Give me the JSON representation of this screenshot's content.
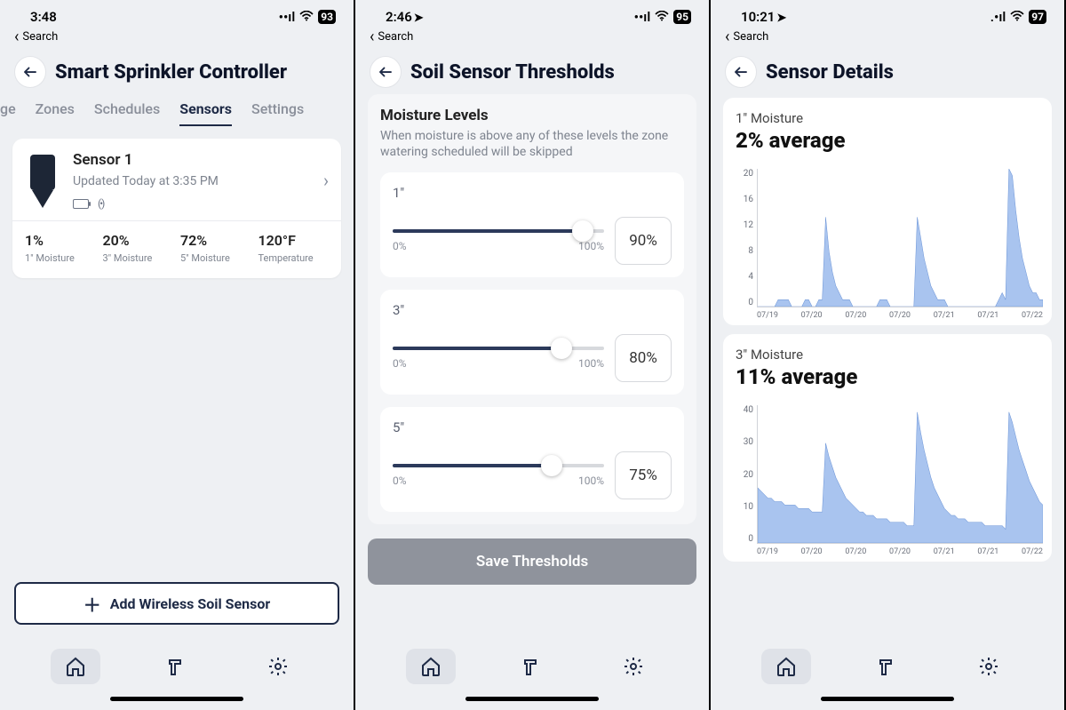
{
  "screens": [
    {
      "status": {
        "time": "3:48",
        "loc": false,
        "battery": "93"
      },
      "back_search": "Search",
      "title": "Smart Sprinkler Controller",
      "tabs": [
        {
          "label": "ge",
          "truncated": true
        },
        {
          "label": "Zones"
        },
        {
          "label": "Schedules"
        },
        {
          "label": "Sensors",
          "active": true
        },
        {
          "label": "Settings"
        }
      ],
      "sensor": {
        "name": "Sensor 1",
        "updated": "Updated Today at 3:35 PM",
        "metrics": [
          {
            "val": "1%",
            "lbl": "1\" Moisture"
          },
          {
            "val": "20%",
            "lbl": "3\" Moisture"
          },
          {
            "val": "72%",
            "lbl": "5\" Moisture"
          },
          {
            "val": "120°F",
            "lbl": "Temperature"
          }
        ]
      },
      "add_btn": "Add Wireless Soil Sensor"
    },
    {
      "status": {
        "time": "2:46",
        "loc": true,
        "battery": "95"
      },
      "back_search": "Search",
      "title": "Soil Sensor Thresholds",
      "section_title": "Moisture Levels",
      "section_desc": "When moisture is above any of these levels the zone watering scheduled will be skipped",
      "thresholds": [
        {
          "depth": "1\"",
          "pct": 90,
          "min": "0%",
          "max": "100%"
        },
        {
          "depth": "3\"",
          "pct": 80,
          "min": "0%",
          "max": "100%"
        },
        {
          "depth": "5\"",
          "pct": 75,
          "min": "0%",
          "max": "100%"
        }
      ],
      "save_btn": "Save Thresholds"
    },
    {
      "status": {
        "time": "10:21",
        "loc": true,
        "battery": "97"
      },
      "back_search": "Search",
      "title": "Sensor Details",
      "charts": [
        {
          "sub": "1\" Moisture",
          "title": "2% average"
        },
        {
          "sub": "3\" Moisture",
          "title": "11% average"
        }
      ]
    }
  ],
  "chart_data": [
    {
      "type": "area",
      "title": "1\" Moisture — 2% average",
      "xlabel": "",
      "ylabel": "",
      "ylim": [
        0,
        20
      ],
      "y_ticks": [
        0,
        4,
        8,
        12,
        16,
        20
      ],
      "x_ticks": [
        "07/19",
        "07/20",
        "07/20",
        "07/20",
        "07/21",
        "07/21",
        "07/22"
      ],
      "series": [
        {
          "name": "1\" Moisture",
          "values": [
            0,
            0,
            0,
            0,
            0,
            0,
            1,
            1,
            1,
            1,
            0,
            0,
            0,
            0,
            1,
            1,
            0,
            0,
            1,
            1,
            13,
            8,
            5,
            3,
            2,
            1,
            1,
            1,
            0,
            0,
            0,
            0,
            0,
            0,
            0,
            0,
            1,
            1,
            1,
            0,
            0,
            0,
            0,
            0,
            0,
            0,
            0,
            13,
            10,
            7,
            5,
            3,
            2,
            1,
            1,
            1,
            0,
            0,
            0,
            0,
            0,
            0,
            0,
            0,
            0,
            0,
            0,
            0,
            0,
            0,
            0,
            1,
            2,
            1,
            20,
            19,
            14,
            10,
            7,
            5,
            3,
            2,
            2,
            1,
            1
          ]
        }
      ]
    },
    {
      "type": "area",
      "title": "3\" Moisture — 11% average",
      "xlabel": "",
      "ylabel": "",
      "ylim": [
        0,
        40
      ],
      "y_ticks": [
        0,
        10,
        20,
        30,
        40
      ],
      "x_ticks": [
        "07/19",
        "07/20",
        "07/20",
        "07/20",
        "07/21",
        "07/21",
        "07/22"
      ],
      "series": [
        {
          "name": "3\" Moisture",
          "values": [
            16,
            15,
            14,
            13,
            13,
            12,
            12,
            12,
            11,
            11,
            11,
            11,
            10,
            10,
            10,
            10,
            9,
            9,
            9,
            9,
            29,
            25,
            22,
            19,
            17,
            15,
            13,
            12,
            11,
            10,
            9,
            9,
            8,
            8,
            8,
            7,
            7,
            7,
            7,
            6,
            6,
            6,
            6,
            6,
            5,
            5,
            5,
            38,
            32,
            27,
            23,
            19,
            16,
            14,
            12,
            10,
            9,
            8,
            8,
            7,
            7,
            7,
            6,
            6,
            6,
            6,
            6,
            5,
            5,
            5,
            5,
            5,
            5,
            4,
            38,
            35,
            31,
            27,
            24,
            21,
            18,
            16,
            14,
            12,
            11
          ]
        }
      ]
    }
  ]
}
